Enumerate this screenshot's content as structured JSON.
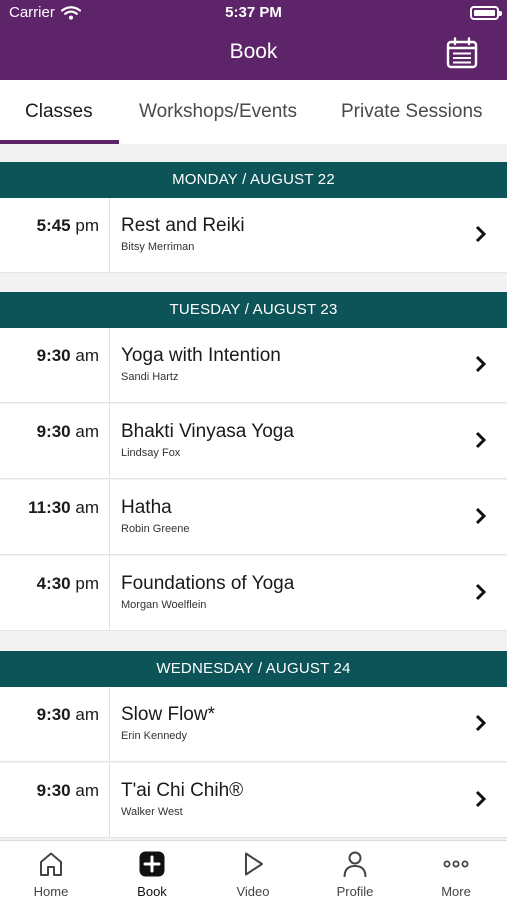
{
  "status": {
    "carrier": "Carrier",
    "time": "5:37 PM"
  },
  "nav": {
    "title": "Book",
    "right_icon": "calendar-icon"
  },
  "tabs": [
    {
      "label": "Classes",
      "active": true
    },
    {
      "label": "Workshops/Events",
      "active": false
    },
    {
      "label": "Private Sessions",
      "active": false
    }
  ],
  "days": [
    {
      "header": "MONDAY / AUGUST 22",
      "classes": [
        {
          "time": "5:45",
          "ampm": "pm",
          "name": "Rest and Reiki",
          "teacher": "Bitsy Merriman"
        }
      ]
    },
    {
      "header": "TUESDAY / AUGUST 23",
      "classes": [
        {
          "time": "9:30",
          "ampm": "am",
          "name": "Yoga with Intention",
          "teacher": "Sandi Hartz"
        },
        {
          "time": "9:30",
          "ampm": "am",
          "name": "Bhakti Vinyasa Yoga",
          "teacher": "Lindsay Fox"
        },
        {
          "time": "11:30",
          "ampm": "am",
          "name": "Hatha",
          "teacher": "Robin Greene"
        },
        {
          "time": "4:30",
          "ampm": "pm",
          "name": "Foundations of Yoga",
          "teacher": "Morgan Woelflein"
        }
      ]
    },
    {
      "header": "WEDNESDAY / AUGUST 24",
      "classes": [
        {
          "time": "9:30",
          "ampm": "am",
          "name": "Slow Flow*",
          "teacher": "Erin Kennedy"
        },
        {
          "time": "9:30",
          "ampm": "am",
          "name": "T'ai Chi Chih®",
          "teacher": "Walker West"
        }
      ]
    }
  ],
  "tabbar": [
    {
      "label": "Home",
      "icon": "home-icon",
      "active": false
    },
    {
      "label": "Book",
      "icon": "plus-square-icon",
      "active": true
    },
    {
      "label": "Video",
      "icon": "play-icon",
      "active": false
    },
    {
      "label": "Profile",
      "icon": "person-icon",
      "active": false
    },
    {
      "label": "More",
      "icon": "more-dots-icon",
      "active": false
    }
  ],
  "colors": {
    "brand": "#5e2469",
    "day_header": "#0d5459",
    "text": "#1a1a1a"
  }
}
